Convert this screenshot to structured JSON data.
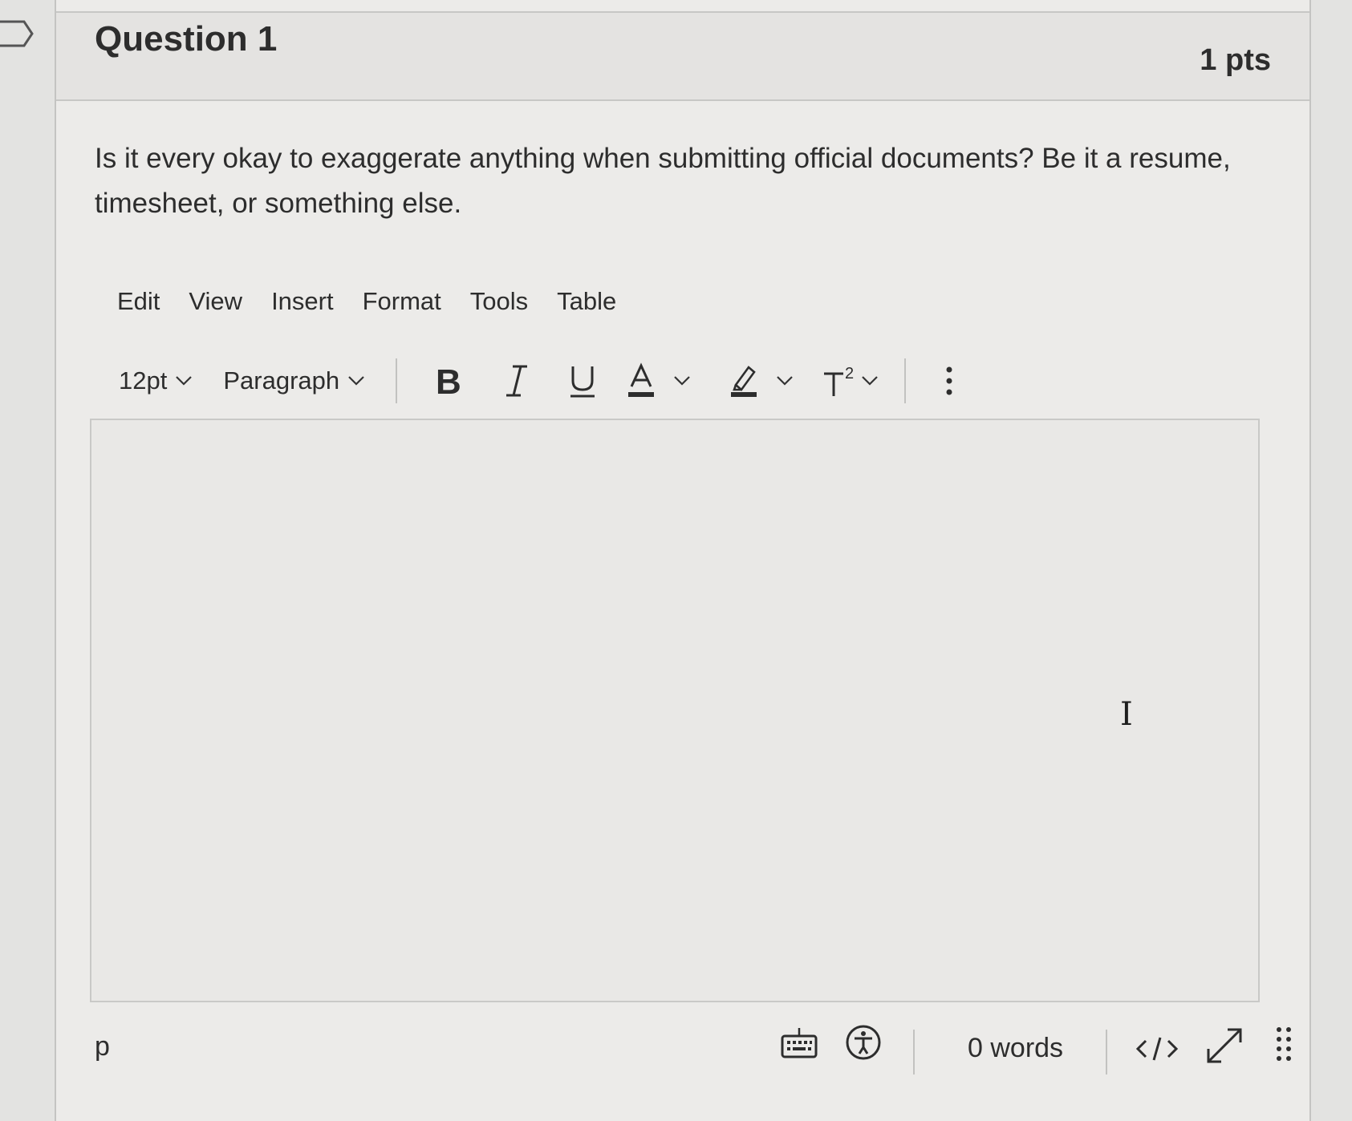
{
  "question": {
    "title": "Question 1",
    "points": "1 pts",
    "text": "Is it every okay to exaggerate anything when submitting official documents? Be it a resume, timesheet, or something else."
  },
  "editor": {
    "menu": [
      "Edit",
      "View",
      "Insert",
      "Format",
      "Tools",
      "Table"
    ],
    "toolbar": {
      "font_size": "12pt",
      "block_format": "Paragraph",
      "bold_icon": "bold-icon",
      "italic_icon": "italic-icon",
      "underline_icon": "underline-icon",
      "text_color_icon": "text-color-icon",
      "highlight_icon": "highlight-icon",
      "superscript_icon": "superscript-icon",
      "more_icon": "more-vertical-icon"
    },
    "content": "",
    "status": {
      "path": "p",
      "word_count": "0 words",
      "icons": [
        "keyboard-icon",
        "accessibility-icon",
        "html-code-icon",
        "fullscreen-icon",
        "resize-grip-icon"
      ]
    }
  },
  "colors": {
    "background": "#e3e3e1",
    "text": "#2d2d2d",
    "border": "#c7c7c5"
  }
}
